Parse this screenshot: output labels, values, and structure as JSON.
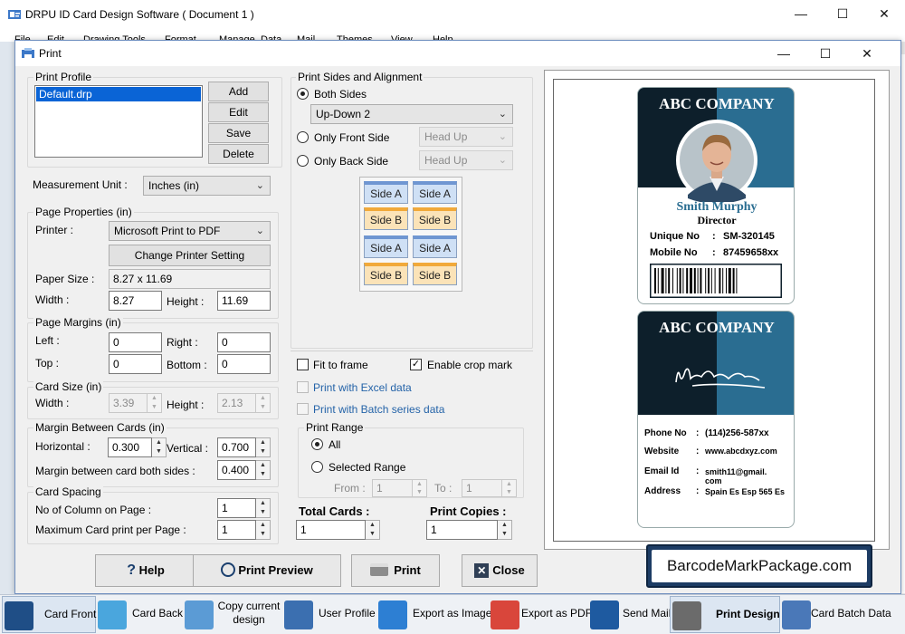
{
  "app": {
    "title": "DRPU ID Card Design Software ( Document 1 )"
  },
  "menu": [
    "File",
    "Edit",
    "Drawing Tools",
    "Format",
    "Manage",
    "Data",
    "Mail",
    "Themes",
    "View",
    "Help"
  ],
  "dialog": {
    "title": "Print",
    "print_profile": {
      "title": "Print Profile",
      "items": [
        "Default.drp"
      ],
      "buttons": {
        "add": "Add",
        "edit": "Edit",
        "save": "Save",
        "delete": "Delete"
      }
    },
    "measurement": {
      "label": "Measurement Unit :",
      "value": "Inches (in)"
    },
    "page_properties": {
      "title": "Page Properties (in)",
      "printer_label": "Printer :",
      "printer": "Microsoft Print to PDF",
      "change_printer": "Change Printer Setting",
      "paper_size_label": "Paper Size :",
      "paper_size": "8.27 x 11.69",
      "width_label": "Width :",
      "width": "8.27",
      "height_label": "Height :",
      "height": "11.69"
    },
    "page_margins": {
      "title": "Page Margins (in)",
      "left_label": "Left :",
      "left": "0",
      "right_label": "Right :",
      "right": "0",
      "top_label": "Top :",
      "top": "0",
      "bottom_label": "Bottom :",
      "bottom": "0"
    },
    "card_size": {
      "title": "Card Size (in)",
      "width_label": "Width :",
      "width": "3.39",
      "height_label": "Height :",
      "height": "2.13"
    },
    "margin_between": {
      "title": "Margin Between Cards (in)",
      "horizontal_label": "Horizontal :",
      "horizontal": "0.300",
      "vertical_label": "Vertical :",
      "vertical": "0.700",
      "both_label": "Margin between card both sides :",
      "both": "0.400"
    },
    "card_spacing": {
      "title": "Card Spacing",
      "columns_label": "No of Column on Page :",
      "columns": "1",
      "max_label": "Maximum Card print per Page :",
      "max": "1"
    },
    "sides": {
      "title": "Print Sides and Alignment",
      "both": "Both Sides",
      "both_mode": "Up-Down 2",
      "front": "Only Front Side",
      "front_mode": "Head Up",
      "back": "Only Back Side",
      "back_mode": "Head Up",
      "side_a": "Side A",
      "side_b": "Side B"
    },
    "options": {
      "fit_to_frame": "Fit to frame",
      "crop_mark": "Enable crop mark",
      "excel": "Print with Excel data",
      "batch": "Print with Batch series data"
    },
    "print_range": {
      "title": "Print Range",
      "all": "All",
      "selected": "Selected Range",
      "from_label": "From :",
      "from": "1",
      "to_label": "To :",
      "to": "1"
    },
    "totals": {
      "total_cards_label": "Total Cards :",
      "total_cards": "1",
      "copies_label": "Print Copies :",
      "copies": "1"
    },
    "buttons": {
      "help": "Help",
      "preview": "Print Preview",
      "print": "Print",
      "close": "Close"
    }
  },
  "card_front": {
    "company": "ABC COMPANY",
    "name": "Smith Murphy",
    "role": "Director",
    "unique_label": "Unique No",
    "unique": "SM-320145",
    "mobile_label": "Mobile No",
    "mobile": "87459658xx"
  },
  "card_back": {
    "company": "ABC COMPANY",
    "phone_label": "Phone No",
    "phone": "(114)256-587xx",
    "website_label": "Website",
    "website": "www.abcdxyz.com",
    "email_label": "Email Id",
    "email": "smith11@gmail. com",
    "address_label": "Address",
    "address": "Spain Es Esp 565 Es"
  },
  "watermark": "BarcodeMarkPackage.com",
  "toolbar": [
    "Card Front",
    "Card Back",
    "Copy current design",
    "User Profile",
    "Export as Image",
    "Export as PDF",
    "Send Mail",
    "Print Design",
    "Card Batch Data"
  ],
  "colors": {
    "card_dark": "#0d1f2b",
    "card_teal": "#2a6d91",
    "accent_blue": "#0a64d6"
  }
}
